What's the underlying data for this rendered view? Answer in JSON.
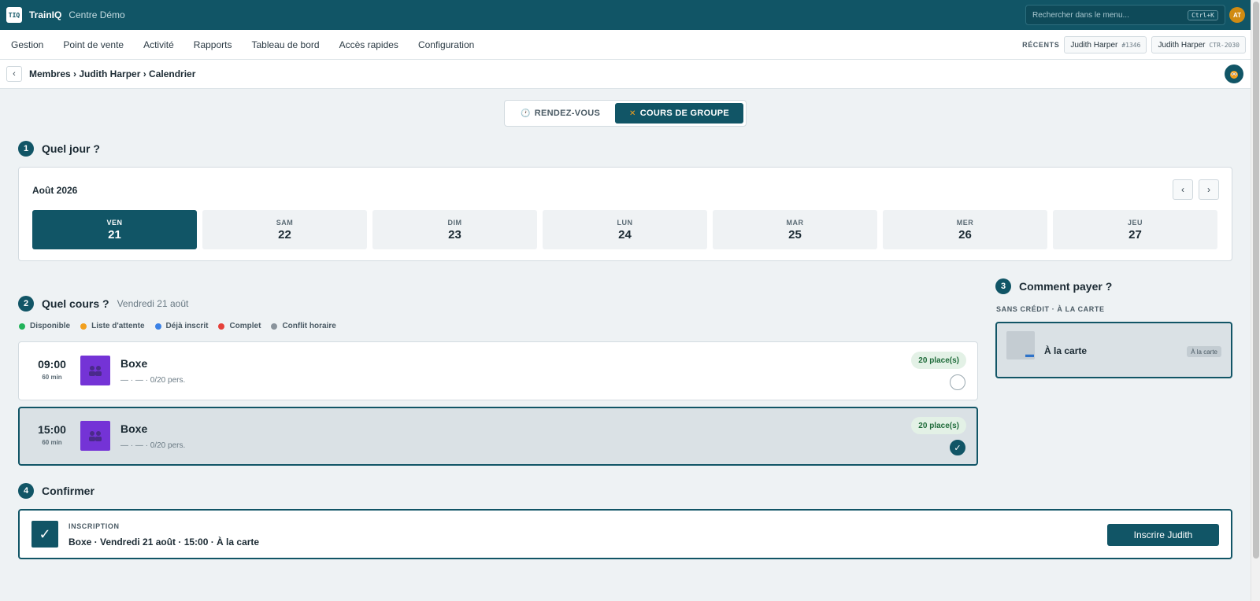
{
  "topbar": {
    "logo": "TIQ",
    "brand": "TrainIQ",
    "center": "Centre Démo",
    "search_placeholder": "Rechercher dans le menu...",
    "search_shortcut": "Ctrl+K",
    "avatar": "AT"
  },
  "menu": {
    "items": [
      "Gestion",
      "Point de vente",
      "Activité",
      "Rapports",
      "Tableau de bord",
      "Accès rapides",
      "Configuration"
    ],
    "recents_label": "RÉCENTS",
    "recents": [
      {
        "name": "Judith Harper",
        "code": "#1346"
      },
      {
        "name": "Judith Harper",
        "code": "CTR-2030"
      }
    ]
  },
  "breadcrumb": {
    "back": "‹",
    "path": "Membres › Judith Harper › Calendrier"
  },
  "mode_toggle": {
    "options": [
      {
        "label": "RENDEZ-VOUS",
        "icon": "clock-icon",
        "selected": false
      },
      {
        "label": "COURS DE GROUPE",
        "icon": "group-icon",
        "selected": true
      }
    ]
  },
  "step1": {
    "num": "1",
    "title": "Quel jour ?",
    "month": "Août 2026",
    "prev": "‹",
    "next": "›",
    "days": [
      {
        "name": "VEN",
        "num": "21",
        "selected": true
      },
      {
        "name": "SAM",
        "num": "22",
        "selected": false
      },
      {
        "name": "DIM",
        "num": "23",
        "selected": false
      },
      {
        "name": "LUN",
        "num": "24",
        "selected": false
      },
      {
        "name": "MAR",
        "num": "25",
        "selected": false
      },
      {
        "name": "MER",
        "num": "26",
        "selected": false
      },
      {
        "name": "JEU",
        "num": "27",
        "selected": false
      }
    ]
  },
  "step2": {
    "num": "2",
    "title": "Quel cours ?",
    "subtitle": "Vendredi 21 août",
    "legend": [
      {
        "label": "Disponible",
        "color": "#22b35a"
      },
      {
        "label": "Liste d'attente",
        "color": "#f2a01e"
      },
      {
        "label": "Déjà inscrit",
        "color": "#3b82e6"
      },
      {
        "label": "Complet",
        "color": "#e5413a"
      },
      {
        "label": "Conflit horaire",
        "color": "#8a949c"
      }
    ],
    "courses": [
      {
        "time": "09:00",
        "duration": "60 min",
        "name": "Boxe",
        "meta": "— · — · 0/20 pers.",
        "badge": "20 place(s)",
        "selected": false,
        "icon_color": "#7433d6"
      },
      {
        "time": "15:00",
        "duration": "60 min",
        "name": "Boxe",
        "meta": "— · — · 0/20 pers.",
        "badge": "20 place(s)",
        "selected": true,
        "icon_color": "#7433d6"
      }
    ]
  },
  "step3": {
    "num": "3",
    "title": "Comment payer ?",
    "label": "SANS CRÉDIT · À LA CARTE",
    "option": {
      "name": "À la carte",
      "tag": "À la carte"
    }
  },
  "step4": {
    "num": "4",
    "title": "Confirmer",
    "label": "INSCRIPTION",
    "summary": "Boxe · Vendredi 21 août · 15:00 · À la carte",
    "button": "Inscrire Judith"
  },
  "colors": {
    "primary": "#115566",
    "background": "#eef2f4",
    "course_icon": "#7433d6",
    "badge_bg": "#e3f1e6",
    "badge_text": "#1f6b3a"
  }
}
